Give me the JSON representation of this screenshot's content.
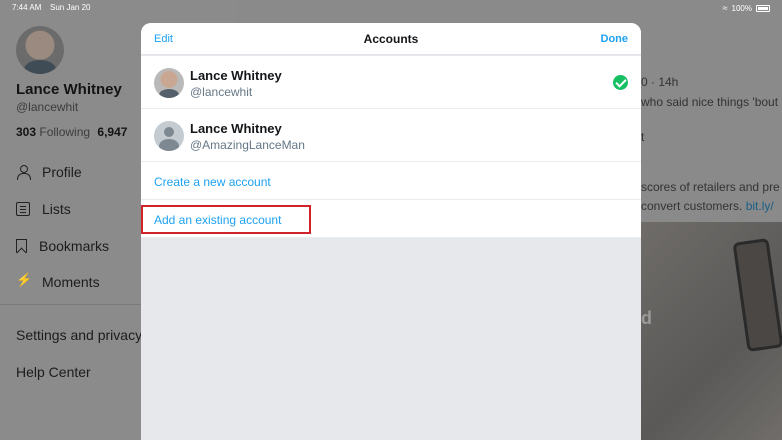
{
  "status_bar": {
    "time": "7:44 AM",
    "date": "Sun Jan 20",
    "battery": "100%"
  },
  "sidebar": {
    "name": "Lance Whitney",
    "handle": "@lancewhit",
    "following_count": "303",
    "following_label": "Following",
    "followers_count": "6,947",
    "items": [
      {
        "label": "Profile",
        "icon": "profile-icon"
      },
      {
        "label": "Lists",
        "icon": "lists-icon"
      },
      {
        "label": "Bookmarks",
        "icon": "bookmark-icon"
      },
      {
        "label": "Moments",
        "icon": "moments-icon"
      }
    ],
    "links": [
      "Settings and privacy",
      "Help Center"
    ]
  },
  "timeline": {
    "snippet_time": "0 · 14h",
    "snippet_line1": "who said nice things 'bout O",
    "snippet_line2": "t",
    "snippet_line3": "scores of retailers and pre",
    "snippet_line4": "convert customers.",
    "snippet_link": "bit.ly/",
    "overlay_letter": "d"
  },
  "modal": {
    "edit_label": "Edit",
    "title": "Accounts",
    "done_label": "Done",
    "accounts": [
      {
        "name": "Lance Whitney",
        "handle": "@lancewhit",
        "active": true
      },
      {
        "name": "Lance Whitney",
        "handle": "@AmazingLanceMan",
        "active": false
      }
    ],
    "create_label": "Create a new account",
    "add_existing_label": "Add an existing account"
  },
  "colors": {
    "accent": "#1da1f2",
    "check": "#17bf63",
    "highlight": "#d0232a"
  }
}
